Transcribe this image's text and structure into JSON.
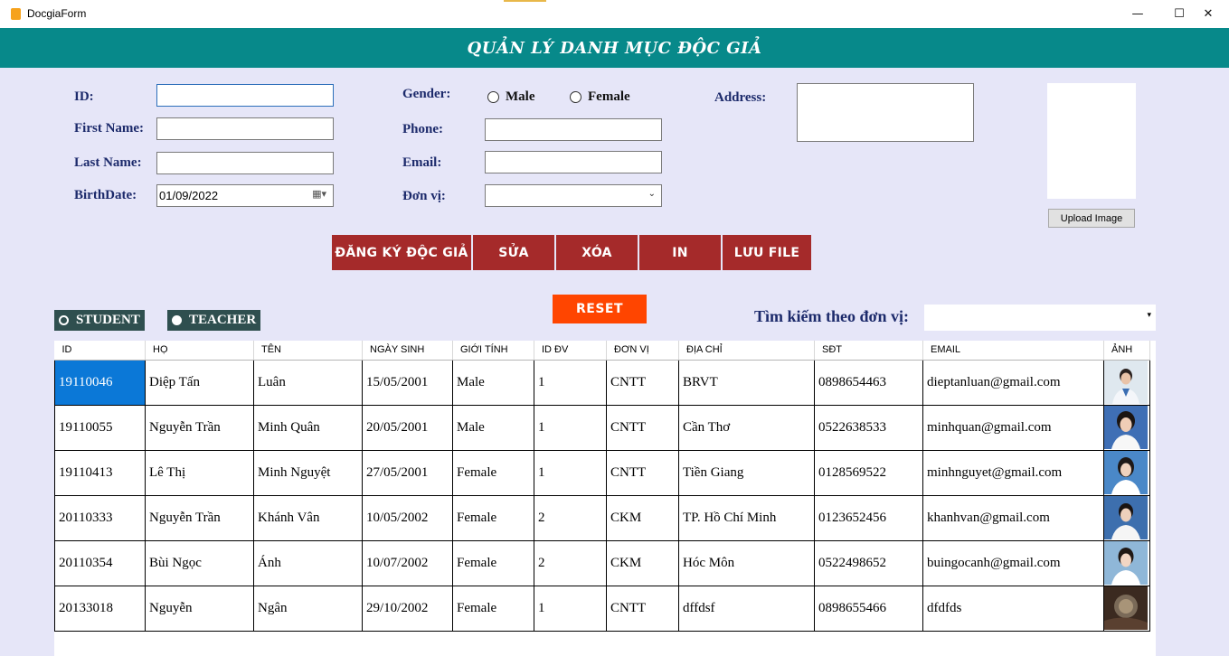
{
  "window": {
    "title": "DocgiaForm"
  },
  "header": {
    "title": "QUẢN LÝ DANH MỤC ĐỘC GIẢ"
  },
  "form": {
    "id_label": "ID:",
    "id_value": "",
    "first_name_label": "First Name:",
    "first_name_value": "",
    "last_name_label": "Last Name:",
    "last_name_value": "",
    "birthdate_label": "BirthDate:",
    "birthdate_value": "01/09/2022",
    "gender_label": "Gender:",
    "gender_male": "Male",
    "gender_female": "Female",
    "phone_label": "Phone:",
    "phone_value": "",
    "email_label": "Email:",
    "email_value": "",
    "donvi_label": "Đơn vị:",
    "donvi_value": "",
    "address_label": "Address:",
    "address_value": ""
  },
  "upload_label": "Upload Image",
  "actions": {
    "register": "ĐĂNG KÝ ĐỘC GIẢ",
    "edit": "SỬA",
    "delete": "XÓA",
    "print": "IN",
    "save_file": "LƯU FILE",
    "reset": "RESET"
  },
  "filters": {
    "student": "STUDENT",
    "teacher": "TEACHER",
    "search_label": "Tìm kiếm theo đơn vị:",
    "search_value": ""
  },
  "table": {
    "columns": [
      "ID",
      "HỌ",
      "TÊN",
      "NGÀY SINH",
      "GIỚI TÍNH",
      "ID ĐV",
      "ĐƠN VỊ",
      "ĐỊA CHỈ",
      "SĐT",
      "EMAIL",
      "ẢNH"
    ],
    "rows": [
      [
        "19110046",
        "Diệp Tấn",
        "Luân",
        "15/05/2001",
        "Male",
        "1",
        "CNTT",
        "BRVT",
        "0898654463",
        "dieptanluan@gmail.com"
      ],
      [
        "19110055",
        "Nguyễn Trần",
        "Minh Quân",
        "20/05/2001",
        "Male",
        "1",
        "CNTT",
        "Cần Thơ",
        "0522638533",
        "minhquan@gmail.com"
      ],
      [
        "19110413",
        "Lê Thị",
        "Minh Nguyệt",
        "27/05/2001",
        "Female",
        "1",
        "CNTT",
        "Tiền Giang",
        "0128569522",
        "minhnguyet@gmail.com"
      ],
      [
        "20110333",
        "Nguyễn Trần",
        "Khánh Vân",
        "10/05/2002",
        "Female",
        "2",
        "CKM",
        "TP. Hồ Chí Minh",
        "0123652456",
        "khanhvan@gmail.com"
      ],
      [
        "20110354",
        "Bùi Ngọc",
        "Ánh",
        "10/07/2002",
        "Female",
        "2",
        "CKM",
        "Hóc Môn",
        "0522498652",
        "buingocanh@gmail.com"
      ],
      [
        "20133018",
        "Nguyễn",
        "Ngân",
        "29/10/2002",
        "Female",
        "1",
        "CNTT",
        "dffdsf",
        "0898655466",
        "dfdfds"
      ]
    ]
  },
  "colors": {
    "header_bg": "#07898a",
    "form_bg": "#e6e6f8",
    "action_button": "#a52a2a",
    "reset_button": "#ff4500",
    "filter_bg": "#2f4f4f",
    "label_text": "#1c2a6b",
    "selected_cell": "#0b78d7"
  }
}
